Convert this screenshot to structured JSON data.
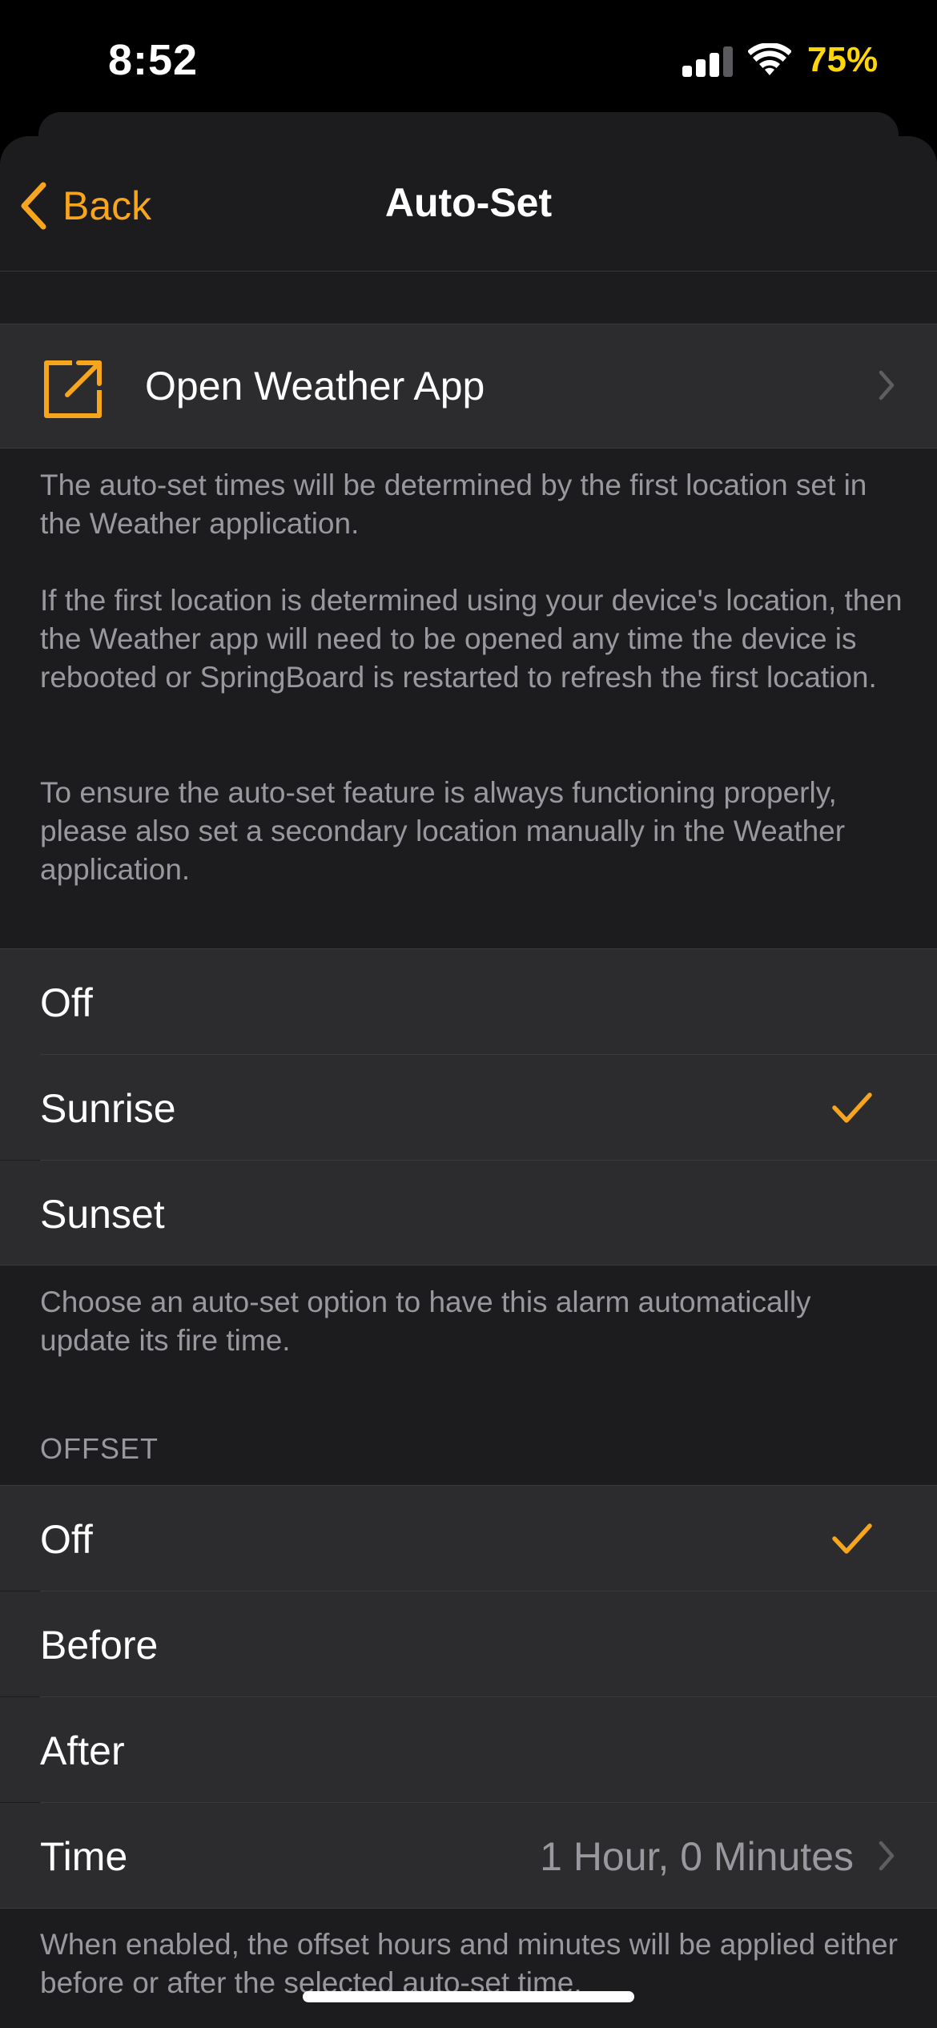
{
  "colors": {
    "accent": "#f7a51c",
    "text_primary": "#ffffff",
    "text_secondary": "#98989e",
    "battery": "#ffd60a",
    "sheet": "#1c1c1e",
    "cell": "#2c2c2e"
  },
  "status_bar": {
    "time": "8:52",
    "battery": "75%",
    "signal_icon": "cellular-signal-icon",
    "wifi_icon": "wifi-icon"
  },
  "nav": {
    "back_label": "Back",
    "title": "Auto-Set"
  },
  "weather_link": {
    "label": "Open Weather App",
    "icon": "external-link-icon"
  },
  "weather_footer": [
    "The auto-set times will be determined by the first location set in the Weather application.",
    "If the first location is determined using your device's location, then the Weather app will need to be opened any time the device is rebooted or SpringBoard is restarted to refresh the first location.",
    "To ensure the auto-set feature is always functioning properly, please also set a secondary location manually in the Weather application."
  ],
  "autoset_options": {
    "items": [
      {
        "label": "Off",
        "selected": false
      },
      {
        "label": "Sunrise",
        "selected": true
      },
      {
        "label": "Sunset",
        "selected": false
      }
    ],
    "footer": "Choose an auto-set option to have this alarm automatically update its fire time."
  },
  "offset": {
    "header": "OFFSET",
    "items": [
      {
        "label": "Off",
        "selected": true
      },
      {
        "label": "Before",
        "selected": false
      },
      {
        "label": "After",
        "selected": false
      }
    ],
    "time_label": "Time",
    "time_value": "1 Hour, 0 Minutes",
    "footer": "When enabled, the offset hours and minutes will be applied either before or after the selected auto-set time."
  }
}
